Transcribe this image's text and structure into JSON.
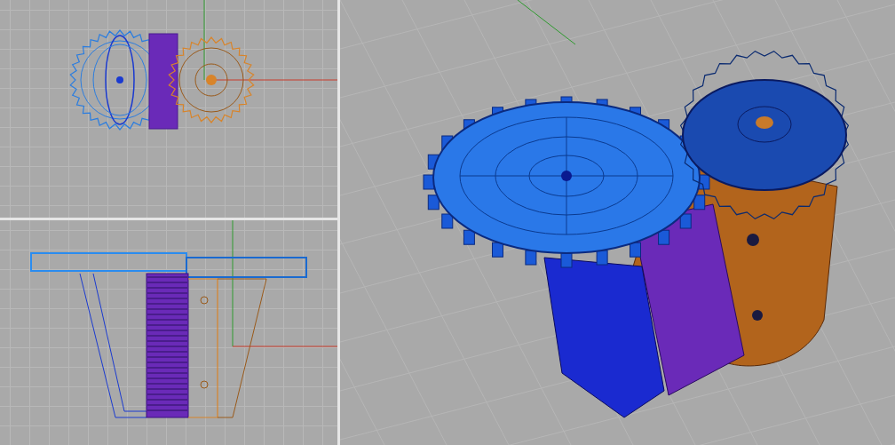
{
  "viewports": [
    {
      "kind": "top"
    },
    {
      "kind": "front"
    },
    {
      "kind": "perspective"
    }
  ]
}
